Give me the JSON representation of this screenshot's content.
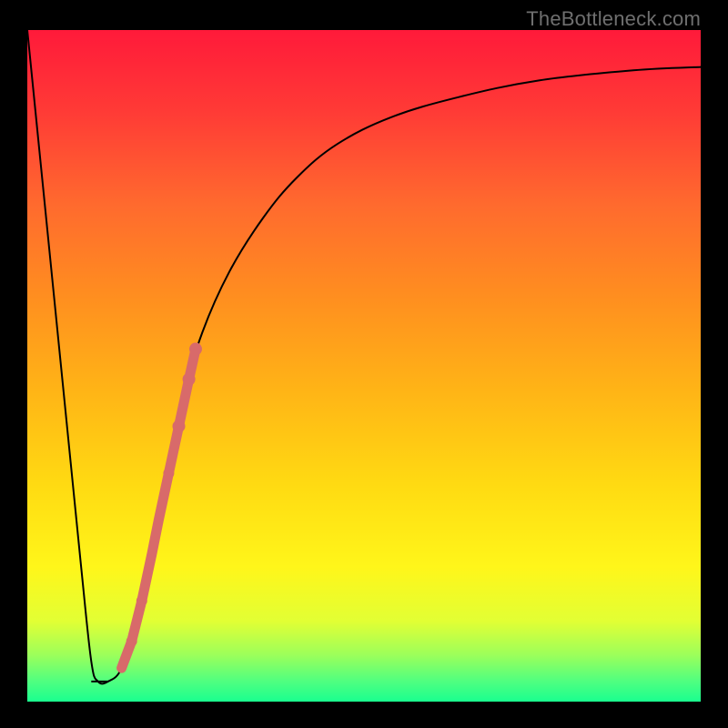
{
  "watermark": "TheBottleneck.com",
  "chart_data": {
    "type": "line",
    "title": "",
    "xlabel": "",
    "ylabel": "",
    "xlim": [
      0,
      100
    ],
    "ylim": [
      0,
      100
    ],
    "series": [
      {
        "name": "bottleneck-curve",
        "stroke": "#000000",
        "stroke_width": 2,
        "x": [
          0,
          2,
          4,
          6,
          8,
          9.5,
          10.5,
          12,
          14,
          16,
          18,
          20,
          23,
          26,
          30,
          35,
          40,
          46,
          54,
          64,
          76,
          90,
          100
        ],
        "y": [
          100,
          80,
          60,
          40,
          20,
          6,
          3,
          3,
          5,
          12,
          22,
          32,
          45,
          55,
          64,
          72,
          78,
          83,
          87,
          90,
          92.5,
          94,
          94.5
        ]
      }
    ],
    "flat_bottom": {
      "x_start": 9.5,
      "x_end": 12,
      "y": 3
    },
    "markers": {
      "name": "sample-dots",
      "fill": "#d86a6a",
      "points": [
        {
          "x": 14.0,
          "y": 5.0,
          "r": 5
        },
        {
          "x": 15.5,
          "y": 9.0,
          "r": 6
        },
        {
          "x": 17.0,
          "y": 15.0,
          "r": 6
        },
        {
          "x": 18.5,
          "y": 22.0,
          "r": 5
        },
        {
          "x": 19.5,
          "y": 27.0,
          "r": 5
        },
        {
          "x": 21.0,
          "y": 34.0,
          "r": 6
        },
        {
          "x": 22.5,
          "y": 41.0,
          "r": 7
        },
        {
          "x": 24.0,
          "y": 48.0,
          "r": 7
        },
        {
          "x": 25.0,
          "y": 52.5,
          "r": 7
        }
      ]
    },
    "colors": {
      "gradient_top": "#ff1a3a",
      "gradient_bottom": "#1aff8f",
      "frame": "#000000",
      "marker": "#d86a6a"
    }
  }
}
